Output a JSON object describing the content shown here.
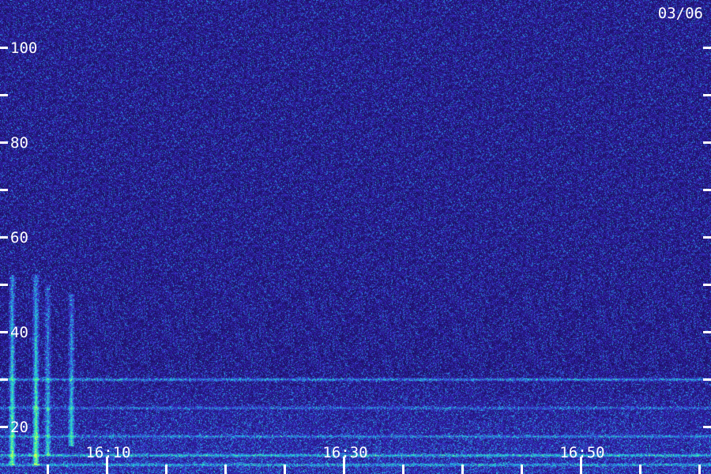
{
  "chart_data": {
    "type": "heatmap",
    "title": "",
    "date": "03/06",
    "xlabel": "",
    "ylabel": "",
    "x_axis": {
      "start": "16:01",
      "end": "17:01",
      "major_ticks": [
        "16:10",
        "16:30",
        "16:50"
      ],
      "minor_tick_interval_minutes": 5
    },
    "y_axis": {
      "ylim": [
        10,
        110
      ],
      "labels": [
        20,
        40,
        60,
        80,
        100
      ],
      "minor_tick_interval": 10
    },
    "colormap": [
      "#1a0f5c",
      "#3a28c8",
      "#22b8e8",
      "#38f0a0",
      "#c8ff60"
    ],
    "features": [
      {
        "kind": "burst",
        "time": "16:02",
        "freq_range": [
          12,
          52
        ],
        "intensity": 0.8
      },
      {
        "kind": "burst",
        "time": "16:04",
        "freq_range": [
          12,
          52
        ],
        "intensity": 0.85
      },
      {
        "kind": "burst",
        "time": "16:05",
        "freq_range": [
          14,
          50
        ],
        "intensity": 0.55
      },
      {
        "kind": "burst",
        "time": "16:07",
        "freq_range": [
          16,
          48
        ],
        "intensity": 0.6
      },
      {
        "kind": "band",
        "freq": 30,
        "time_range": [
          "16:01",
          "17:01"
        ],
        "intensity": 0.45
      },
      {
        "kind": "band",
        "freq": 24,
        "time_range": [
          "16:01",
          "17:01"
        ],
        "intensity": 0.3
      },
      {
        "kind": "band",
        "freq": 18,
        "time_range": [
          "16:01",
          "17:01"
        ],
        "intensity": 0.35
      },
      {
        "kind": "band",
        "freq": 14,
        "time_range": [
          "16:01",
          "17:01"
        ],
        "intensity": 0.5
      },
      {
        "kind": "band",
        "freq": 12,
        "time_range": [
          "16:01",
          "17:01"
        ],
        "intensity": 0.4
      }
    ]
  }
}
